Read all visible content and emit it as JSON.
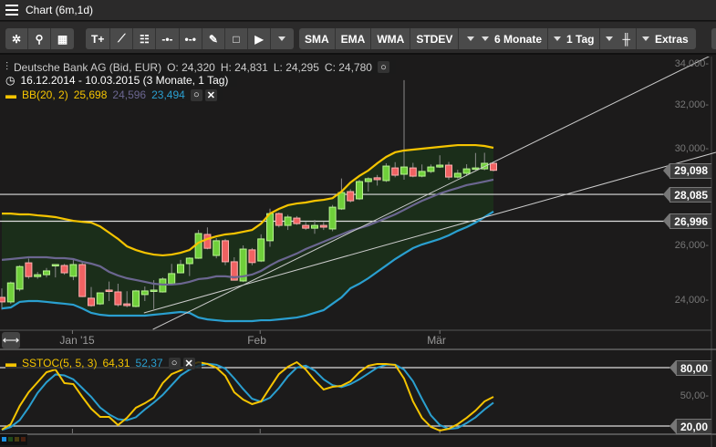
{
  "window": {
    "title": "Chart (6m,1d)"
  },
  "toolbar": {
    "tools": [
      {
        "name": "settings",
        "label": "✲"
      },
      {
        "name": "zoom",
        "label": "⚲"
      },
      {
        "name": "layout",
        "label": "▦"
      }
    ],
    "drawing": [
      {
        "name": "text-add",
        "label": "T+"
      },
      {
        "name": "line",
        "label": "⟋"
      },
      {
        "name": "fibonacci",
        "label": "☷"
      },
      {
        "name": "horizontal-line",
        "label": "-•-"
      },
      {
        "name": "channel",
        "label": "•-•"
      },
      {
        "name": "pencil",
        "label": "✎"
      },
      {
        "name": "rectangle",
        "label": "□"
      },
      {
        "name": "arrow",
        "label": "▶"
      }
    ],
    "indicators": [
      "SMA",
      "EMA",
      "WMA",
      "STDEV"
    ],
    "period": "6 Monate",
    "interval": "1 Tag",
    "chart_type_icon": "candlestick-icon",
    "extras": "Extras"
  },
  "legend": {
    "instrument": "Deutsche Bank AG (Bid, EUR)",
    "open": "O: 24,320",
    "high": "H: 24,831",
    "low": "L: 24,295",
    "close": "C: 24,780",
    "range": "16.12.2014 - 10.03.2015 (3 Monate, 1 Tag)",
    "bb_label": "BB(20, 2)",
    "bb_upper": "25,698",
    "bb_mid": "24,596",
    "bb_lower": "23,494",
    "stoch_label": "SSTOC(5, 5, 3)",
    "stoch_k": "64,31",
    "stoch_d": "52,37"
  },
  "colors": {
    "bg": "#1c1b1b",
    "bull": "#6fcf3a",
    "bear": "#f06262",
    "bb_upper": "#f5c400",
    "bb_mid": "#6b6690",
    "bb_lower": "#2a9fd0",
    "band_fill": "#1b2e1a",
    "stoch_k": "#f5c400",
    "stoch_d": "#2a9fd0"
  },
  "chart_data": [
    {
      "type": "candlestick",
      "title": "Deutsche Bank AG (Bid, EUR)",
      "scale": "log",
      "x_labels": [
        {
          "text": "Jan '15",
          "index": 7.9
        },
        {
          "text": "Feb",
          "index": 28.9
        },
        {
          "text": "Mär",
          "index": 49
        }
      ],
      "y_ticks": [
        {
          "value": 34000,
          "text": "34,000"
        },
        {
          "value": 32000,
          "text": "32,000"
        },
        {
          "value": 30000,
          "text": "30,000"
        },
        {
          "value": 26000,
          "text": "26,000"
        },
        {
          "value": 24000,
          "text": "24,000"
        }
      ],
      "price_tags": [
        {
          "value": 29098,
          "text": "29,098"
        },
        {
          "value": 28085,
          "text": "28,085"
        },
        {
          "value": 26996,
          "text": "26,996"
        }
      ],
      "horizontal_lines": [
        28085,
        26996
      ],
      "trendlines": [
        {
          "i1": 16.9,
          "p1": 23020,
          "i2": 79.9,
          "p2": 34590
        },
        {
          "i1": 15.9,
          "p1": 23585,
          "i2": 79.9,
          "p2": 29880
        }
      ],
      "ohlc": [
        [
          24130,
          24450,
          23700,
          23970
        ],
        [
          23970,
          24700,
          23900,
          24650
        ],
        [
          24425,
          25300,
          24350,
          25250
        ],
        [
          25390,
          25550,
          24800,
          24880
        ],
        [
          24880,
          25050,
          24800,
          24950
        ],
        [
          24950,
          25200,
          24850,
          25090
        ],
        [
          25290,
          25330,
          24850,
          25325
        ],
        [
          25290,
          25350,
          24950,
          25020
        ],
        [
          24890,
          25500,
          24750,
          25325
        ],
        [
          25325,
          25400,
          24140,
          24160
        ],
        [
          24100,
          24500,
          23800,
          23840
        ],
        [
          23900,
          24300,
          23860,
          24290
        ],
        [
          24390,
          24700,
          24000,
          24360
        ],
        [
          24325,
          24620,
          23800,
          23870
        ],
        [
          23900,
          24350,
          23780,
          23840
        ],
        [
          23810,
          24400,
          23780,
          24360
        ],
        [
          24230,
          24520,
          24000,
          24360
        ],
        [
          24360,
          24750,
          23720,
          24390
        ],
        [
          24325,
          24850,
          24300,
          24790
        ],
        [
          24620,
          25350,
          24600,
          24990
        ],
        [
          25020,
          25500,
          25000,
          25325
        ],
        [
          25360,
          25600,
          24900,
          25565
        ],
        [
          25565,
          26650,
          25540,
          26510
        ],
        [
          26475,
          26750,
          25900,
          25940
        ],
        [
          25667,
          26330,
          25560,
          26230
        ],
        [
          26230,
          26300,
          25300,
          25430
        ],
        [
          25430,
          25600,
          24750,
          24750
        ],
        [
          24720,
          26050,
          24680,
          25910
        ],
        [
          25880,
          25950,
          25300,
          25400
        ],
        [
          25460,
          26480,
          25420,
          26300
        ],
        [
          26230,
          27500,
          26000,
          27300
        ],
        [
          27300,
          27350,
          26750,
          26830
        ],
        [
          26830,
          27250,
          26650,
          27160
        ],
        [
          27120,
          27200,
          26850,
          26900
        ],
        [
          26830,
          26960,
          26650,
          26720
        ],
        [
          26720,
          27050,
          26500,
          26830
        ],
        [
          26830,
          26960,
          26650,
          26760
        ],
        [
          26690,
          27650,
          26600,
          27560
        ],
        [
          27490,
          28750,
          27450,
          28160
        ],
        [
          28200,
          28300,
          27750,
          27820
        ],
        [
          27900,
          28700,
          27850,
          28620
        ],
        [
          28620,
          28800,
          28200,
          28740
        ],
        [
          28780,
          28900,
          28450,
          28700
        ],
        [
          28660,
          29400,
          28600,
          29280
        ],
        [
          29200,
          29450,
          28800,
          28890
        ],
        [
          28930,
          33230,
          28700,
          29240
        ],
        [
          29200,
          29420,
          28800,
          28850
        ],
        [
          28850,
          29350,
          28800,
          29050
        ],
        [
          29050,
          29350,
          28980,
          29240
        ],
        [
          29240,
          29750,
          29200,
          29320
        ],
        [
          29320,
          29460,
          28700,
          28810
        ],
        [
          28810,
          29120,
          28750,
          28970
        ],
        [
          28970,
          29360,
          28850,
          29160
        ],
        [
          29160,
          29850,
          29100,
          29200
        ],
        [
          29160,
          29860,
          29100,
          29400
        ],
        [
          29400,
          29420,
          29050,
          29098
        ]
      ],
      "bb_upper": [
        27300,
        27300,
        27270,
        27270,
        27230,
        27200,
        27160,
        27085,
        27010,
        26970,
        26940,
        26790,
        26545,
        26300,
        26015,
        25875,
        25770,
        25700,
        25670,
        25700,
        25770,
        25875,
        26155,
        26300,
        26400,
        26475,
        26510,
        26580,
        26650,
        26900,
        27300,
        27490,
        27640,
        27710,
        27750,
        27820,
        27860,
        27930,
        28200,
        28580,
        28860,
        29090,
        29400,
        29680,
        29880,
        29960,
        30000,
        30040,
        30080,
        30120,
        30160,
        30200,
        30200,
        30200,
        30160,
        30080
      ],
      "bb_mid": [
        25500,
        25530,
        25565,
        25600,
        25600,
        25600,
        25565,
        25565,
        25530,
        25430,
        25360,
        25260,
        25055,
        24920,
        24820,
        24755,
        24690,
        24620,
        24590,
        24590,
        24620,
        24690,
        24790,
        24820,
        24890,
        24890,
        24855,
        24890,
        24955,
        25090,
        25290,
        25465,
        25600,
        25740,
        25910,
        26050,
        26190,
        26335,
        26475,
        26615,
        26720,
        26830,
        26975,
        27120,
        27270,
        27450,
        27640,
        27820,
        27970,
        28120,
        28240,
        28350,
        28470,
        28540,
        28620,
        28700
      ],
      "bb_lower": [
        23740,
        23775,
        23970,
        24000,
        24000,
        23970,
        23935,
        23905,
        23870,
        23740,
        23585,
        23520,
        23490,
        23490,
        23490,
        23490,
        23490,
        23520,
        23550,
        23585,
        23615,
        23585,
        23425,
        23360,
        23330,
        23300,
        23300,
        23300,
        23300,
        23330,
        23330,
        23360,
        23390,
        23425,
        23490,
        23585,
        23680,
        23905,
        24130,
        24455,
        24620,
        24820,
        25055,
        25290,
        25530,
        25740,
        25945,
        26085,
        26190,
        26300,
        26440,
        26615,
        26760,
        26940,
        27160,
        27380
      ]
    },
    {
      "type": "line",
      "title": "SSTOC(5, 5, 3)",
      "ylim": [
        0,
        100
      ],
      "y_ticks": [
        {
          "value": 50,
          "text": "50,00-"
        }
      ],
      "level_tags": [
        {
          "value": 80,
          "text": "80,00"
        },
        {
          "value": 20,
          "text": "20,00"
        }
      ],
      "series": [
        {
          "name": "%K",
          "values": [
            16.3,
            21.9,
            40.6,
            54.7,
            65,
            75.3,
            78.1,
            64.1,
            63.1,
            50,
            37.8,
            29.4,
            29.4,
            21,
            28.4,
            38.8,
            43.4,
            49.1,
            64.1,
            73.4,
            77.2,
            82.8,
            85.6,
            83.8,
            80,
            71.6,
            54.7,
            47.2,
            42.5,
            45.3,
            59.4,
            73.4,
            80.9,
            85.6,
            78.1,
            66.9,
            57.5,
            60.3,
            61.3,
            65.9,
            75.3,
            81.9,
            83.8,
            83.8,
            82.8,
            68.8,
            45.3,
            28.4,
            19.1,
            15.3,
            17.2,
            21.9,
            28.4,
            35.9,
            45.3,
            50
          ]
        },
        {
          "name": "%D",
          "values": [
            16,
            19,
            26,
            39,
            54,
            65,
            73,
            72,
            68,
            59,
            50,
            39,
            32,
            27,
            26,
            29,
            37,
            44,
            52,
            62,
            72,
            78,
            82,
            84,
            83,
            79,
            69,
            58,
            48,
            45,
            49,
            59,
            71,
            80,
            82,
            77,
            68,
            62,
            60,
            63,
            68,
            74,
            80,
            83,
            83,
            78,
            66,
            48,
            31,
            21,
            17,
            18,
            23,
            29,
            37,
            44
          ]
        }
      ]
    }
  ]
}
